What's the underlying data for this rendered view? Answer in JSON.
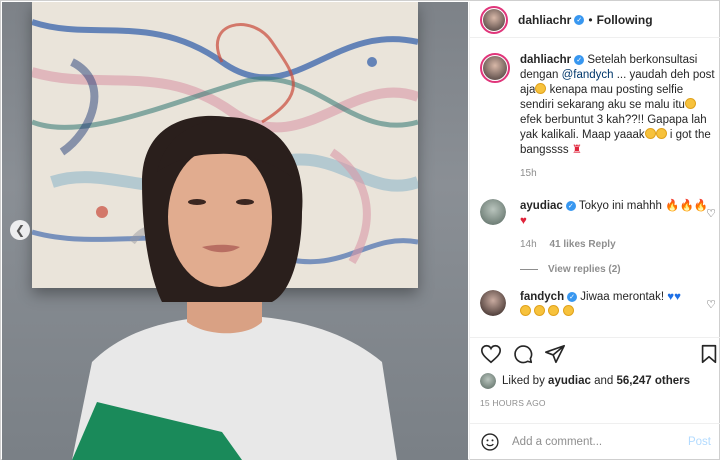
{
  "post": {
    "author": "dahliachr",
    "follow_status": "Following",
    "caption_author": "dahliachr",
    "caption": {
      "part1": "Setelah berkonsultasi dengan",
      "mention": "@fandych",
      "part2": "... yaudah deh post aja",
      "part3": "kenapa mau posting selfie sendiri sekarang aku se malu itu",
      "part4": "efek berbuntut 3 kah??!! Gapapa lah yak kalikali. Maap yaaak",
      "part5": "i got the bangssss"
    },
    "caption_time": "15h",
    "likes_user": "ayudiac",
    "likes_text": "Liked by",
    "likes_and": "and",
    "likes_count": "56,247 others",
    "posted_ago": "15 HOURS AGO"
  },
  "comments": [
    {
      "user": "ayudiac",
      "text": "Tokyo ini mahhh",
      "time": "14h",
      "likes": "41 likes",
      "reply": "Reply",
      "view_replies": "View replies (2)"
    },
    {
      "user": "fandych",
      "text": "Jiwaa merontak!"
    }
  ],
  "composer": {
    "placeholder": "Add a comment...",
    "post_label": "Post"
  },
  "icons": {
    "verified": "verified-badge-icon",
    "heart": "heart-icon",
    "comment": "comment-icon",
    "share": "share-icon",
    "save": "bookmark-icon",
    "emoji": "emoji-icon",
    "prev": "chevron-left-icon"
  },
  "colors": {
    "accent_blue": "#3897f0",
    "link": "#00376b",
    "muted": "#8e8e8e",
    "post_disabled": "#b3dbff"
  }
}
